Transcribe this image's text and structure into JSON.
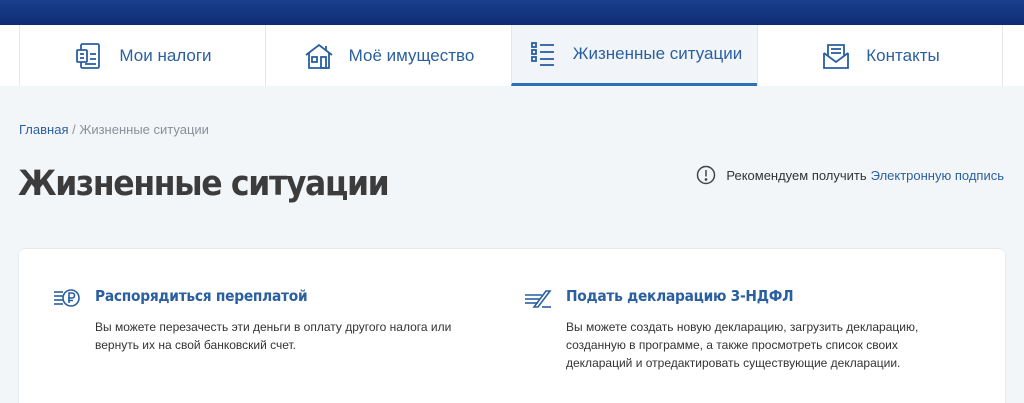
{
  "nav": {
    "items": [
      {
        "label": "Мои налоги",
        "icon": "tax-document-icon"
      },
      {
        "label": "Моё имущество",
        "icon": "house-icon"
      },
      {
        "label": "Жизненные ситуации",
        "icon": "list-icon",
        "active": true
      },
      {
        "label": "Контакты",
        "icon": "envelope-icon"
      }
    ]
  },
  "breadcrumb": {
    "home": "Главная",
    "separator": " / ",
    "current": "Жизненные ситуации"
  },
  "page": {
    "title": "Жизненные ситуации"
  },
  "recommend": {
    "text": "Рекомендуем получить",
    "link": "Электронную подпись",
    "icon": "info-icon"
  },
  "tiles": [
    {
      "icon": "ruble-coins-icon",
      "title": "Распорядиться переплатой",
      "description": "Вы можете перезачесть эти деньги в оплату другого налога или вернуть их на свой банковский счет."
    },
    {
      "icon": "declaration-stack-icon",
      "title": "Подать декларацию 3-НДФЛ",
      "description": "Вы можете создать новую декларацию, загрузить декларацию, созданную в программе, а также просмотреть список своих деклараций и отредактировать существующие декларации."
    }
  ],
  "colors": {
    "accent": "#2a5fa0",
    "header": "#14357f",
    "active_underline": "#2d72b8"
  }
}
